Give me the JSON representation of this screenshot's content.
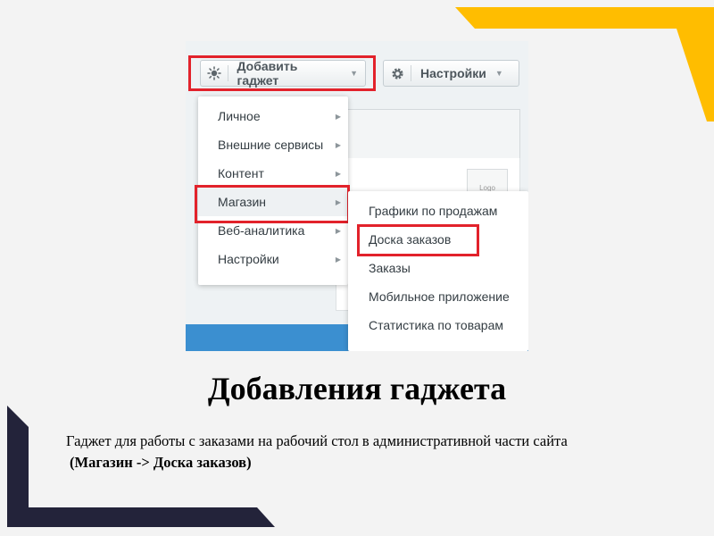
{
  "toolbar": {
    "add_gadget_label": "Добавить гаджет",
    "settings_label": "Настройки"
  },
  "menu": {
    "items": [
      {
        "label": "Личное"
      },
      {
        "label": "Внешние сервисы"
      },
      {
        "label": "Контент"
      },
      {
        "label": "Магазин"
      },
      {
        "label": "Веб-аналитика"
      },
      {
        "label": "Настройки"
      }
    ]
  },
  "submenu": {
    "items": [
      {
        "label": "Графики по продажам"
      },
      {
        "label": "Доска заказов"
      },
      {
        "label": "Заказы"
      },
      {
        "label": "Мобильное приложение"
      },
      {
        "label": "Статистика по товарам"
      }
    ]
  },
  "logo_placeholder": "Logo",
  "slide": {
    "title": "Добавления гаджета",
    "description": "Гаджет для работы с заказами на рабочий стол в административной части сайта",
    "path": "(Магазин -> Доска заказов)"
  },
  "colors": {
    "highlight": "#e2222b",
    "accent_yellow": "#ffbd00",
    "dark_corner": "#23233a",
    "blue_bar": "#3b8fd0"
  },
  "icons": {
    "add_gadget": "sun-icon",
    "settings": "gear-icon",
    "dropdown": "triangle-down-icon",
    "submenu": "triangle-right-icon"
  }
}
